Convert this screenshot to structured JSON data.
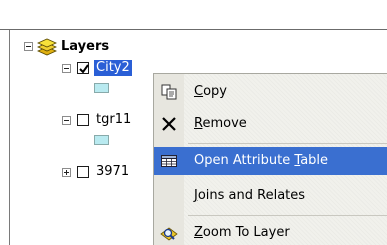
{
  "toc": {
    "root": {
      "label": "Layers",
      "icon": "layers-icon"
    },
    "layers": [
      {
        "label": "City2",
        "checked": true,
        "selected": true,
        "expanded": true,
        "swatch_color": "#b9eaf0"
      },
      {
        "label": "tgr11",
        "checked": false,
        "selected": false,
        "expanded": true,
        "swatch_color": "#b9eaf0"
      },
      {
        "label": "3971",
        "checked": false,
        "selected": false,
        "expanded": false
      }
    ]
  },
  "context_menu": {
    "items": [
      {
        "pre": "",
        "u": "C",
        "post": "opy",
        "icon": "copy-icon"
      },
      {
        "pre": "",
        "u": "R",
        "post": "emove",
        "icon": "remove-icon"
      },
      {
        "pre": "Open Attribute ",
        "u": "T",
        "post": "able",
        "icon": "attribute-table-icon",
        "highlighted": true
      },
      {
        "pre": "",
        "u": "J",
        "post": "oins and Relates",
        "icon": ""
      },
      {
        "pre": "",
        "u": "Z",
        "post": "oom To Layer",
        "icon": "zoom-to-layer-icon"
      }
    ]
  },
  "colors": {
    "selection": "#2a5fd6",
    "menu_highlight": "#3a6fd0",
    "swatch": "#b9eaf0"
  }
}
